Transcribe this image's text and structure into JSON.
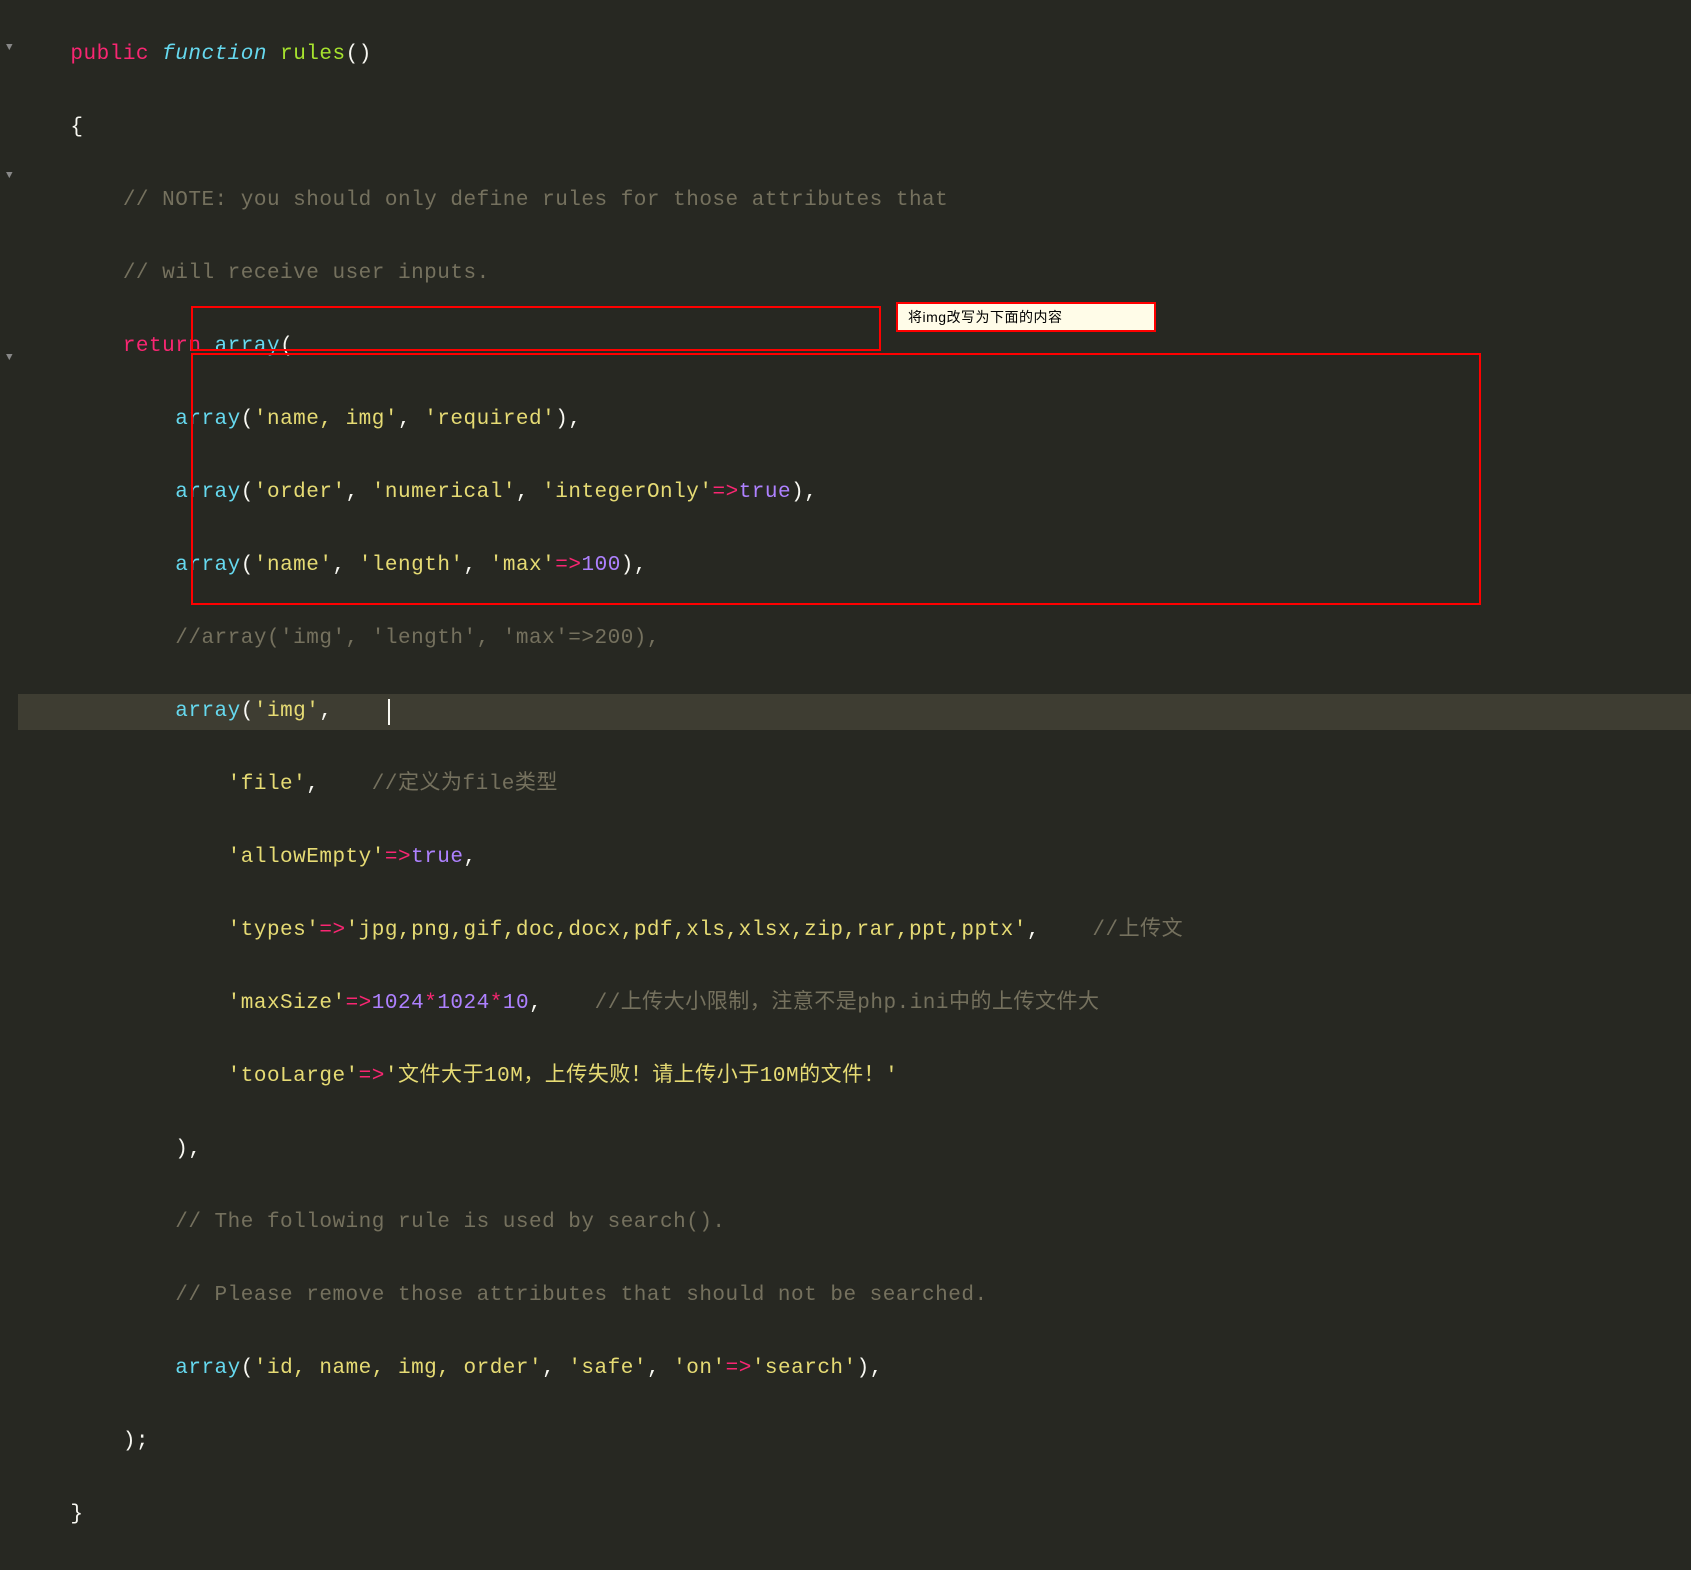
{
  "gutter": {
    "fold_glyph": "▼"
  },
  "annotation": {
    "text": "将img改写为下面的内容"
  },
  "code": {
    "l1": {
      "kw_public": "public",
      "kw_function": "function",
      "fn_name": "rules",
      "paren": "()"
    },
    "l2": {
      "brace": "{"
    },
    "l3": {
      "comment": "// NOTE: you should only define rules for those attributes that"
    },
    "l4": {
      "comment": "// will receive user inputs."
    },
    "l5": {
      "kw_return": "return",
      "call": "array",
      "paren": "("
    },
    "l6": {
      "call": "array",
      "open": "(",
      "s1": "'name, img'",
      "c": ", ",
      "s2": "'required'",
      "close": "),"
    },
    "l7": {
      "call": "array",
      "open": "(",
      "s1": "'order'",
      "c1": ", ",
      "s2": "'numerical'",
      "c2": ", ",
      "s3": "'integerOnly'",
      "arrow": "=>",
      "const": "true",
      "close": "),"
    },
    "l8": {
      "call": "array",
      "open": "(",
      "s1": "'name'",
      "c1": ", ",
      "s2": "'length'",
      "c2": ", ",
      "s3": "'max'",
      "arrow": "=>",
      "num": "100",
      "close": "),"
    },
    "l9": {
      "comment": "//array('img', 'length', 'max'=>200),"
    },
    "l10": {
      "call": "array",
      "open": "(",
      "s1": "'img'",
      "c": ","
    },
    "l11": {
      "s1": "'file'",
      "c": ",",
      "comment": "//定义为file类型"
    },
    "l12": {
      "s1": "'allowEmpty'",
      "arrow": "=>",
      "const": "true",
      "c": ","
    },
    "l13": {
      "s1": "'types'",
      "arrow": "=>",
      "s2": "'jpg,png,gif,doc,docx,pdf,xls,xlsx,zip,rar,ppt,pptx'",
      "c": ",",
      "comment": "//上传文"
    },
    "l14": {
      "s1": "'maxSize'",
      "arrow": "=>",
      "n1": "1024",
      "op1": "*",
      "n2": "1024",
      "op2": "*",
      "n3": "10",
      "c": ",",
      "comment": "//上传大小限制，注意不是php.ini中的上传文件大"
    },
    "l15": {
      "s1": "'tooLarge'",
      "arrow": "=>",
      "s2": "'文件大于10M，上传失败！请上传小于10M的文件！'"
    },
    "l16": {
      "close": "),"
    },
    "l17": {
      "comment": "// The following rule is used by search()."
    },
    "l18": {
      "comment": "// Please remove those attributes that should not be searched."
    },
    "l19": {
      "call": "array",
      "open": "(",
      "s1": "'id, name, img, order'",
      "c1": ", ",
      "s2": "'safe'",
      "c2": ", ",
      "s3": "'on'",
      "arrow": "=>",
      "s4": "'search'",
      "close": "),"
    },
    "l20": {
      "close": ");"
    },
    "l21": {
      "brace": "}"
    }
  }
}
